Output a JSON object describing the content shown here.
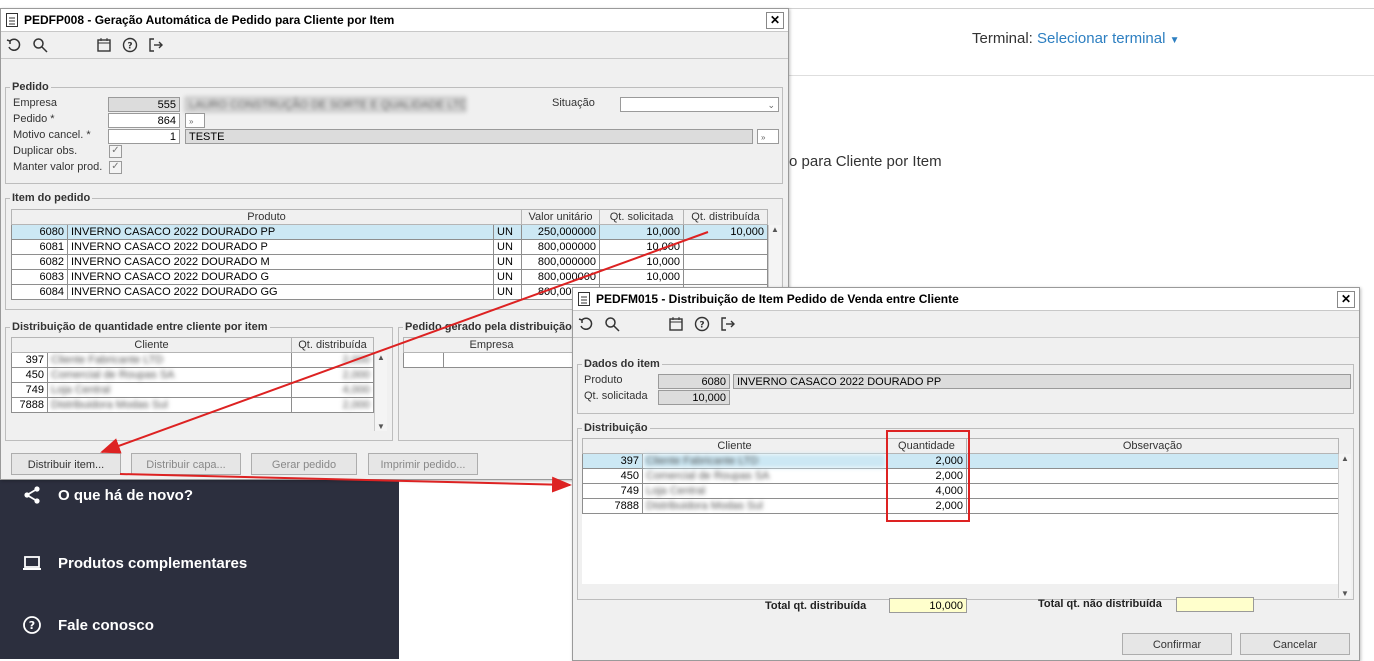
{
  "bg": {
    "terminal_label": "Terminal:",
    "terminal_link": "Selecionar terminal",
    "partial_text": "o para Cliente por Item",
    "menu": [
      {
        "icon": "share-icon",
        "label": "O que há de novo?"
      },
      {
        "icon": "laptop-icon",
        "label": "Produtos complementares"
      },
      {
        "icon": "help-circle-icon",
        "label": "Fale conosco"
      }
    ]
  },
  "win1": {
    "title": "PEDFP008 - Geração Automática de Pedido para Cliente por Item",
    "pedido": {
      "legend": "Pedido",
      "empresa_label": "Empresa",
      "empresa_value": "555",
      "empresa_name": "LAURO CONSTRUÇÃO DE SORTE E QUALIDADE LTDA",
      "pedido_label": "Pedido *",
      "pedido_value": "864",
      "motivo_label": "Motivo cancel. *",
      "motivo_value": "1",
      "motivo_desc": "TESTE",
      "situacao_label": "Situação",
      "duplicar_label": "Duplicar obs.",
      "manter_label": "Manter valor prod."
    },
    "itens": {
      "legend": "Item do pedido",
      "headers": [
        "Produto",
        "Valor unitário",
        "Qt. solicitada",
        "Qt. distribuída"
      ],
      "rows": [
        {
          "code": "6080",
          "name": "INVERNO CASACO 2022 DOURADO PP",
          "un": "UN",
          "valor": "250,000000",
          "qtsol": "10,000",
          "qtdist": "10,000"
        },
        {
          "code": "6081",
          "name": "INVERNO CASACO 2022 DOURADO P",
          "un": "UN",
          "valor": "800,000000",
          "qtsol": "10,000",
          "qtdist": ""
        },
        {
          "code": "6082",
          "name": "INVERNO CASACO 2022 DOURADO M",
          "un": "UN",
          "valor": "800,000000",
          "qtsol": "10,000",
          "qtdist": ""
        },
        {
          "code": "6083",
          "name": "INVERNO CASACO 2022 DOURADO G",
          "un": "UN",
          "valor": "800,000000",
          "qtsol": "10,000",
          "qtdist": ""
        },
        {
          "code": "6084",
          "name": "INVERNO CASACO 2022 DOURADO GG",
          "un": "UN",
          "valor": "800,000000",
          "qtsol": "",
          "qtdist": ""
        }
      ]
    },
    "dist": {
      "legend": "Distribuição de quantidade entre cliente por item",
      "headers": [
        "Cliente",
        "Qt. distribuída"
      ],
      "rows": [
        {
          "code": "397",
          "name": "Cliente Fabricante LTD",
          "qt": "2,000"
        },
        {
          "code": "450",
          "name": "Comercial de Roupas SA",
          "qt": "2,000"
        },
        {
          "code": "749",
          "name": "Loja Central",
          "qt": "4,000"
        },
        {
          "code": "7888",
          "name": "Distribuidora Modas Sul",
          "qt": "2,000"
        }
      ]
    },
    "pedgerado": {
      "legend": "Pedido gerado pela distribuição",
      "header": "Empresa"
    },
    "buttons": [
      "Distribuir item...",
      "Distribuir capa...",
      "Gerar pedido",
      "Imprimir pedido..."
    ]
  },
  "win2": {
    "title": "PEDFM015 - Distribuição de Item Pedido de Venda entre Cliente",
    "dados": {
      "legend": "Dados do item",
      "produto_label": "Produto",
      "produto_code": "6080",
      "produto_name": "INVERNO CASACO 2022 DOURADO PP",
      "qtsol_label": "Qt. solicitada",
      "qtsol_value": "10,000"
    },
    "dist": {
      "legend": "Distribuição",
      "headers": [
        "Cliente",
        "Quantidade",
        "Observação"
      ],
      "rows": [
        {
          "code": "397",
          "name": "Cliente Fabricante LTD",
          "qt": "2,000",
          "obs": ""
        },
        {
          "code": "450",
          "name": "Comercial de Roupas SA",
          "qt": "2,000",
          "obs": ""
        },
        {
          "code": "749",
          "name": "Loja Central",
          "qt": "4,000",
          "obs": ""
        },
        {
          "code": "7888",
          "name": "Distribuidora Modas Sul",
          "qt": "2,000",
          "obs": ""
        }
      ]
    },
    "total_label": "Total qt. distribuída",
    "total_value": "10,000",
    "total_nao_label": "Total qt. não distribuída",
    "total_nao_value": "",
    "confirmar": "Confirmar",
    "cancelar": "Cancelar"
  },
  "colors": {
    "annotation": "#dd2222",
    "selected_row": "#cce8f4",
    "dark_menu": "#2c2f3e",
    "link": "#2d7fc1"
  }
}
